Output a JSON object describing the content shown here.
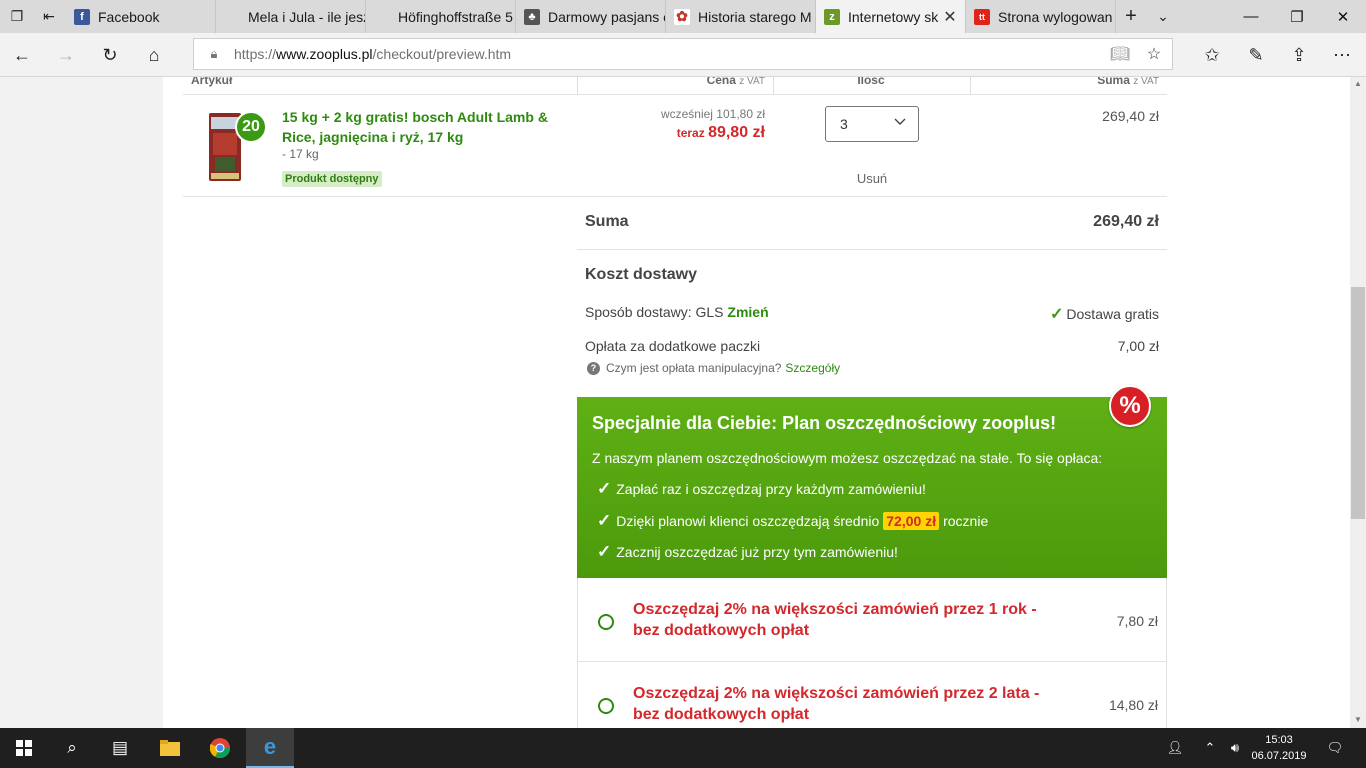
{
  "browser": {
    "tabs": [
      {
        "title": "Facebook",
        "icon": "facebook-icon",
        "color": "#3b5998",
        "glyph": "f"
      },
      {
        "title": "Mela i Jula - ile jesz",
        "icon": "blank-page-icon",
        "color": "",
        "glyph": ""
      },
      {
        "title": "Höfinghoffstraße 5",
        "icon": "blank-page-icon",
        "color": "",
        "glyph": ""
      },
      {
        "title": "Darmowy pasjans c",
        "icon": "cards-icon",
        "color": "#555555",
        "glyph": "♣"
      },
      {
        "title": "Historia starego M",
        "icon": "flower-icon",
        "color": "#c0392b",
        "glyph": "✿"
      },
      {
        "title": "Internetowy sk",
        "icon": "zooplus-icon",
        "color": "#6b9a2a",
        "glyph": "z"
      },
      {
        "title": "Strona wylogowan",
        "icon": "tt-icon",
        "color": "#e0241b",
        "glyph": "tt"
      }
    ],
    "url_prefix": "https://",
    "url_domain": "www.zooplus.pl",
    "url_path": "/checkout/preview.htm"
  },
  "table": {
    "col_article": "Artykuł",
    "col_price": "Cena",
    "col_qty": "Ilość",
    "col_sum": "Suma",
    "vat_note": "z VAT"
  },
  "product": {
    "name": "15 kg + 2 kg gratis! bosch Adult Lamb & Rice, jagnięcina i ryż, 17 kg",
    "variant": "- 17 kg",
    "badge": "Produkt dostępny",
    "image_badge": "20",
    "price_before": "wcześniej 101,80 zł",
    "price_now_label": "teraz",
    "price_now": "89,80 zł",
    "qty": "3",
    "remove": "Usuń",
    "line_total": "269,40 zł"
  },
  "summary": {
    "sum_label": "Suma",
    "sum_value": "269,40 zł",
    "shipping_title": "Koszt dostawy",
    "method_label": "Sposób dostawy: GLS",
    "method_change": "Zmień",
    "free_label": "Dostawa gratis",
    "extra_label": "Opłata za dodatkowe paczki",
    "extra_value": "7,00 zł",
    "info_text": "Czym jest opłata manipulacyjna?",
    "info_link": "Szczegóły"
  },
  "plan": {
    "title": "Specjalnie dla Ciebie: Plan oszczędnościowy zooplus!",
    "lead": "Z naszym planem oszczędnościowym możesz oszczędzać na stałe. To się opłaca:",
    "bullet1": "Zapłać raz i oszczędzaj przy każdym zamówieniu!",
    "bullet2_pre": "Dzięki planowi klienci oszczędzają średnio",
    "bullet2_hl": "72,00 zł",
    "bullet2_post": "rocznie",
    "bullet3": "Zacznij oszczędzać już przy tym zamówieniu!",
    "badge": "%",
    "options": [
      {
        "label": "Oszczędzaj 2% na większości zamówień przez 1 rok - bez dodatkowych opłat",
        "price": "7,80 zł"
      },
      {
        "label": "Oszczędzaj 2% na większości zamówień przez 2 lata - bez dodatkowych opłat",
        "price": "14,80 zł"
      }
    ]
  },
  "taskbar": {
    "time": "15:03",
    "date": "06.07.2019"
  },
  "colors": {
    "accent_green": "#2f8a10",
    "plan_green": "#56a411",
    "price_red": "#d3282c"
  }
}
